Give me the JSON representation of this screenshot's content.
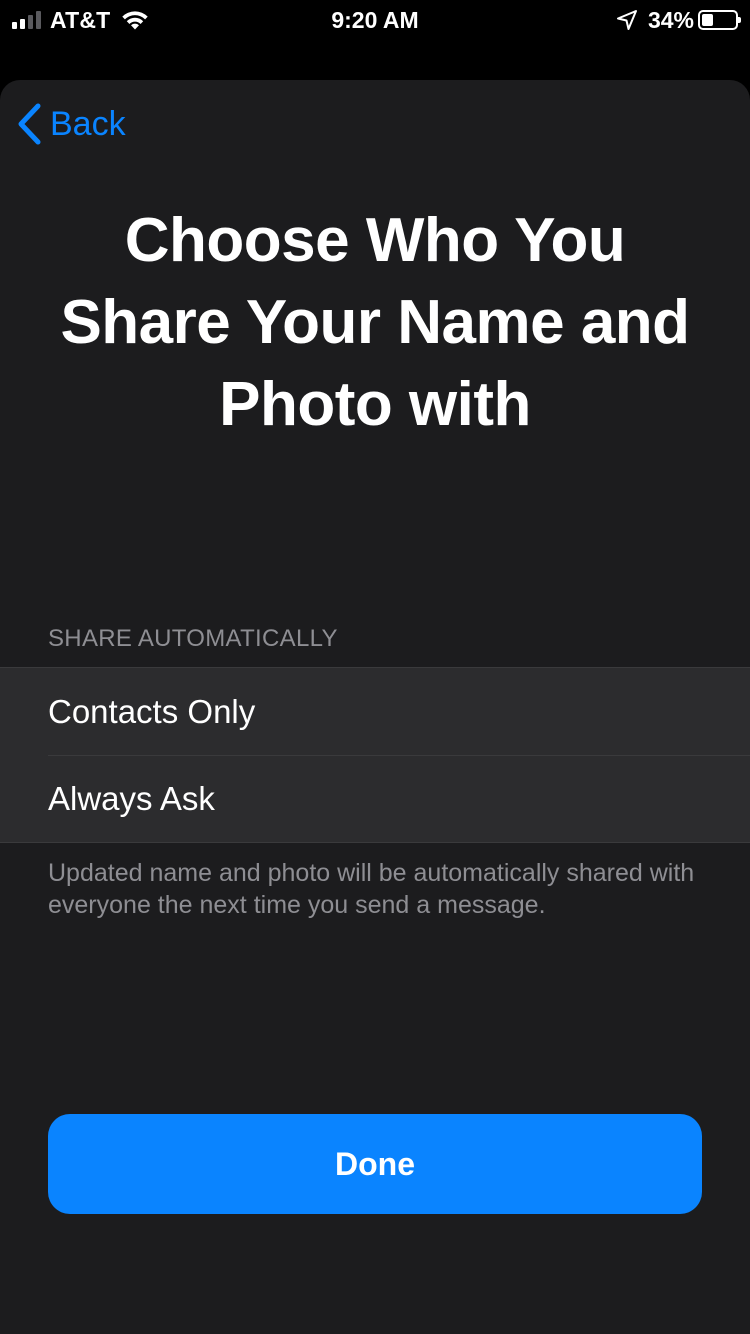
{
  "status_bar": {
    "carrier": "AT&T",
    "time": "9:20 AM",
    "battery_percent": "34%",
    "battery_level": 0.34,
    "signal_bars_active": 2,
    "signal_bars_total": 4,
    "icons": [
      "signal-icon",
      "wifi-icon",
      "location-arrow-icon",
      "battery-icon"
    ]
  },
  "nav": {
    "back_label": "Back",
    "back_icon": "chevron-left-icon"
  },
  "title": "Choose Who You Share Your Name and Photo with",
  "section": {
    "header": "SHARE AUTOMATICALLY",
    "options": [
      {
        "label": "Contacts Only"
      },
      {
        "label": "Always Ask"
      }
    ],
    "footer": "Updated name and photo will be automatically shared with everyone the next time you send a message."
  },
  "done_label": "Done",
  "colors": {
    "accent": "#0a84ff",
    "sheet_background": "#1c1c1e",
    "row_background": "#2c2c2e",
    "secondary_text": "#8e8e93"
  }
}
